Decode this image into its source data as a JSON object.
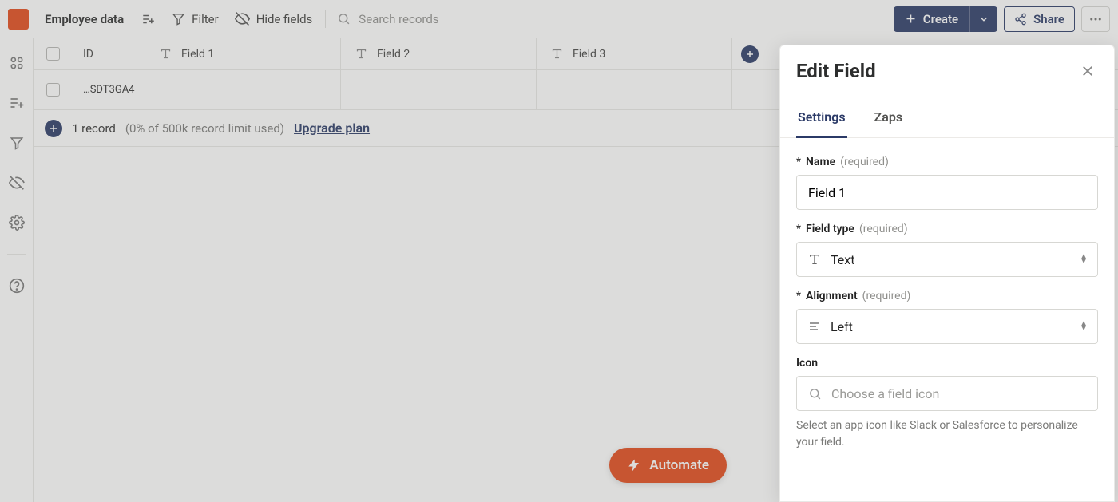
{
  "topbar": {
    "title": "Employee data",
    "filter_label": "Filter",
    "hide_fields_label": "Hide fields",
    "search_placeholder": "Search records",
    "create_label": "Create",
    "share_label": "Share"
  },
  "grid": {
    "id_header": "ID",
    "columns": [
      "Field 1",
      "Field 2",
      "Field 3"
    ],
    "rows": [
      {
        "id": "…SDT3GA4",
        "cells": [
          "",
          "",
          ""
        ]
      }
    ]
  },
  "footer": {
    "count_text": "1 record",
    "limit_text": "(0% of 500k record limit used)",
    "upgrade_text": "Upgrade plan"
  },
  "automate": {
    "label": "Automate"
  },
  "panel": {
    "title": "Edit Field",
    "tabs": {
      "settings": "Settings",
      "zaps": "Zaps"
    },
    "name": {
      "label": "Name",
      "hint": "(required)",
      "value": "Field 1"
    },
    "field_type": {
      "label": "Field type",
      "hint": "(required)",
      "value": "Text"
    },
    "alignment": {
      "label": "Alignment",
      "hint": "(required)",
      "value": "Left"
    },
    "icon": {
      "label": "Icon",
      "placeholder": "Choose a field icon",
      "help": "Select an app icon like Slack or Salesforce to personalize your field."
    }
  }
}
